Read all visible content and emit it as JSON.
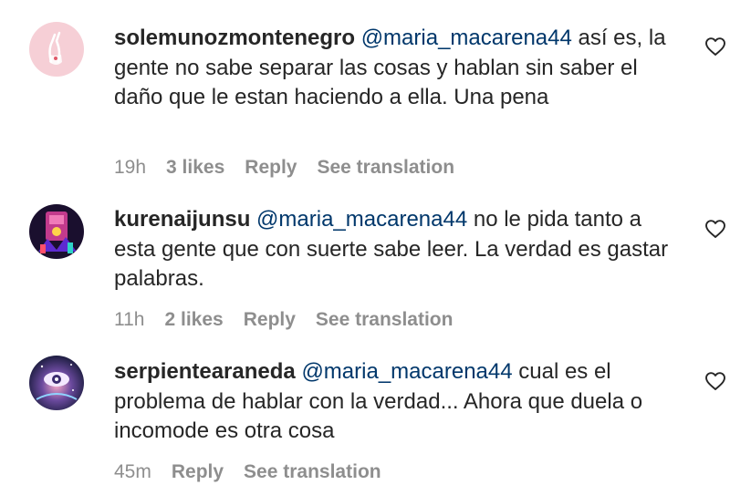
{
  "comments": [
    {
      "username": "solemunozmontenegro",
      "mention": "@maria_macarena44",
      "text": "así es, la gente no sabe separar las cosas y hablan sin saber el daño que le estan haciendo a ella. Una pena",
      "timestamp": "19h",
      "likes": "3 likes",
      "reply_label": "Reply",
      "translate_label": "See translation",
      "avatar_icon": "crossed-fingers-sticker-icon",
      "like_icon": "heart-outline-icon"
    },
    {
      "username": "kurenaijunsu",
      "mention": "@maria_macarena44",
      "text": "no le pida tanto a esta gente que con suerte sabe leer. La verdad es gastar palabras.",
      "timestamp": "11h",
      "likes": "2 likes",
      "reply_label": "Reply",
      "translate_label": "See translation",
      "avatar_icon": "neon-illustration-avatar-icon",
      "like_icon": "heart-outline-icon"
    },
    {
      "username": "serpientearaneda",
      "mention": "@maria_macarena44",
      "text": "cual es el problema de hablar con la verdad... Ahora que duela o incomode es otra cosa",
      "timestamp": "45m",
      "reply_label": "Reply",
      "translate_label": "See translation",
      "avatar_icon": "cosmic-eye-avatar-icon",
      "like_icon": "heart-outline-icon"
    }
  ],
  "colors": {
    "text": "#262626",
    "mention": "#00376b",
    "secondary": "#8e8e8e"
  }
}
